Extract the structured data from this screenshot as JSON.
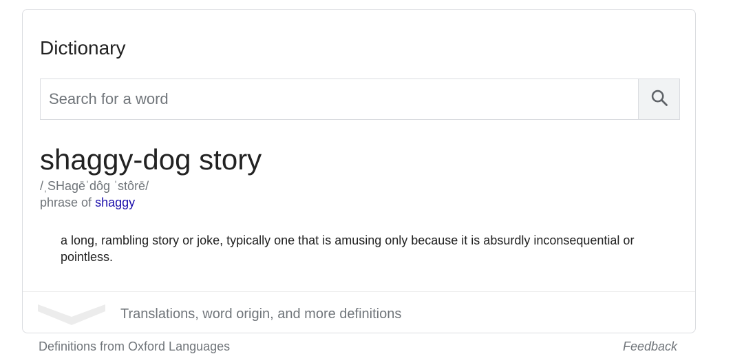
{
  "dictionary": {
    "title": "Dictionary",
    "search": {
      "placeholder": "Search for a word",
      "value": "",
      "icon": "search-icon"
    },
    "entry": {
      "headword": "shaggy-dog story",
      "pronunciation": "/ˌSHagēˈdôg ˈstôrē/",
      "phrase_prefix": "phrase of ",
      "phrase_link": "shaggy",
      "definition": "a long, rambling story or joke, typically one that is amusing only because it is absurdly inconsequential or pointless."
    },
    "more": {
      "label": "Translations, word origin, and more definitions",
      "icon": "chevron-down-icon"
    }
  },
  "footer": {
    "left": "Definitions from Oxford Languages",
    "right": "Feedback"
  },
  "colors": {
    "link": "#1a0dab",
    "muted": "#70757a",
    "border": "#dadce0"
  }
}
